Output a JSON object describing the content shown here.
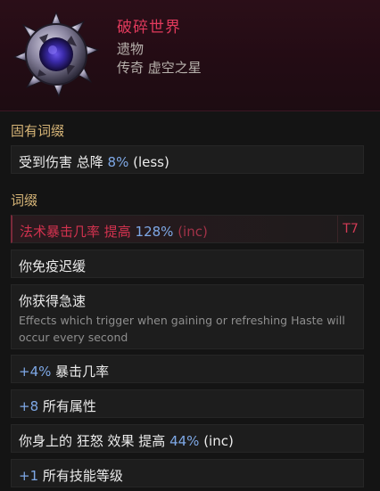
{
  "item": {
    "name": "破碎世界",
    "base_type": "遗物",
    "rarity_line": "传奇 虚空之星",
    "icon": "void-star-orb-icon"
  },
  "sections": {
    "implicit_label": "固有词缀",
    "affix_label": "词缀"
  },
  "implicit": {
    "prefix": "受到伤害 总降 ",
    "value": "8%",
    "suffix": " (less)"
  },
  "affixes": {
    "spell_crit": {
      "prefix": "法术暴击几率 提高 ",
      "value": "128%",
      "suffix": " (inc)",
      "tier": "T7"
    },
    "freeze_immune": {
      "text": "你免疫迟缓"
    },
    "haste": {
      "text": "你获得急速",
      "desc": "Effects which trigger when gaining or refreshing Haste will occur every second"
    },
    "crit_chance": {
      "value": "+4%",
      "suffix": " 暴击几率"
    },
    "all_attributes": {
      "value": "+8",
      "suffix": " 所有属性"
    },
    "frenzy_effect": {
      "prefix": "你身上的 狂怒 效果 提高 ",
      "value": "44%",
      "suffix": " (inc)"
    },
    "skill_levels": {
      "value": "+1",
      "suffix": " 所有技能等级"
    }
  },
  "colors": {
    "title": "#e03a5c",
    "value_blue": "#7ea8e6",
    "section_gold": "#d8b678",
    "tier_red": "#d23b55"
  }
}
